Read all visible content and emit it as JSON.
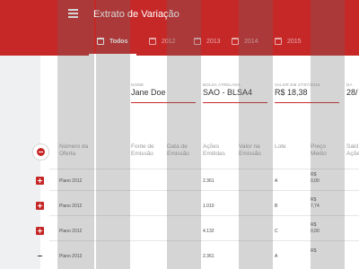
{
  "appbar": {
    "title": "Extrato de Variação",
    "color": "#c62828"
  },
  "tabs": [
    {
      "label": "Todos",
      "active": true
    },
    {
      "label": "2012"
    },
    {
      "label": "2013"
    },
    {
      "label": "2014"
    },
    {
      "label": "2015"
    }
  ],
  "fields": [
    {
      "label": "Nome",
      "value": "Jane Doe"
    },
    {
      "label": "Bolsa atrelada",
      "value": "SAO - BLSA4"
    },
    {
      "label": "Valor em 27/07/2016",
      "value": "R$ 18,38"
    },
    {
      "label": "Da",
      "value": "28/"
    }
  ],
  "table": {
    "headers": [
      "Número da Oferta",
      "Fonte de Emissão",
      "Data de Emissão",
      "Ações Emitidas",
      "Valor na Emissão",
      "Lote",
      "Preço Médio",
      "Sald Açõe"
    ],
    "rows": [
      {
        "offer": "Plano 2012",
        "shares": "2.361",
        "lot": "A",
        "price_currency": "R$",
        "price": "0,00"
      },
      {
        "offer": "Plano 2012",
        "shares": "1.010",
        "lot": "B",
        "price_currency": "R$",
        "price": "7,74"
      },
      {
        "offer": "Plano 2012",
        "shares": "4.132",
        "lot": "C",
        "price_currency": "R$",
        "price": "0,00"
      },
      {
        "offer": "Plano 2013",
        "shares": "2.361",
        "lot": "A",
        "price_currency": "R$",
        "price": ""
      }
    ]
  }
}
